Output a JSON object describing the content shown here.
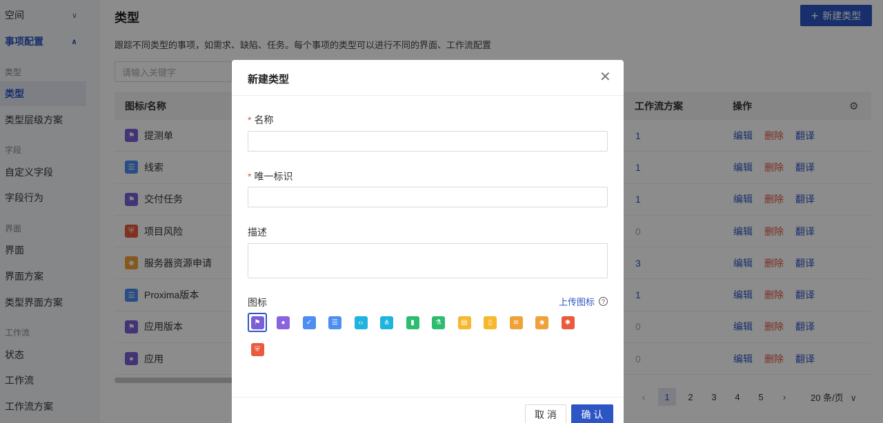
{
  "sidebar": {
    "space": "空间",
    "item_config": "事项配置",
    "section_type": "类型",
    "type": "类型",
    "type_level": "类型层级方案",
    "section_field": "字段",
    "custom_field": "自定义字段",
    "field_behavior": "字段行为",
    "section_screen": "界面",
    "screen": "界面",
    "screen_scheme": "界面方案",
    "type_screen_scheme": "类型界面方案",
    "section_workflow": "工作流",
    "status": "状态",
    "workflow": "工作流",
    "workflow_scheme": "工作流方案"
  },
  "page": {
    "title": "类型",
    "description": "跟踪不同类型的事项，如需求、缺陷、任务。每个事项的类型可以进行不同的界面、工作流配置",
    "new_button": "新建类型",
    "search_placeholder": "请输入关键字"
  },
  "table": {
    "col_name": "图标/名称",
    "col_workflow": "工作流方案",
    "col_ops": "操作",
    "op_edit": "编辑",
    "op_delete": "删除",
    "op_translate": "翻译",
    "rows": [
      {
        "name": "提测单",
        "workflow": "1",
        "icon": "flag-icon",
        "color": "#7b5fd6"
      },
      {
        "name": "线索",
        "workflow": "1",
        "icon": "list-icon",
        "color": "#4e8ef0"
      },
      {
        "name": "交付任务",
        "workflow": "1",
        "icon": "flag-icon",
        "color": "#7b5fd6"
      },
      {
        "name": "项目风险",
        "workflow": "0",
        "icon": "shield-icon",
        "color": "#e95a3f"
      },
      {
        "name": "服务器资源申请",
        "workflow": "3",
        "icon": "person-icon",
        "color": "#f0a23a"
      },
      {
        "name": "Proxima版本",
        "workflow": "1",
        "icon": "list-icon",
        "color": "#4e8ef0"
      },
      {
        "name": "应用版本",
        "workflow": "0",
        "icon": "flag-icon",
        "color": "#7b5fd6"
      },
      {
        "name": "应用",
        "workflow": "0",
        "icon": "bulb-icon",
        "color": "#7b5fd6"
      }
    ]
  },
  "pagination": {
    "pages": [
      "1",
      "2",
      "3",
      "4",
      "5"
    ],
    "current": "1",
    "page_size": "20 条/页"
  },
  "modal": {
    "title": "新建类型",
    "name_label": "名称",
    "key_label": "唯一标识",
    "desc_label": "描述",
    "icon_label": "图标",
    "upload_icon": "上传图标",
    "cancel": "取 消",
    "confirm": "确 认",
    "required_mark": "*",
    "icons": [
      {
        "name": "flag-icon",
        "color": "#7b5fd6",
        "glyph": "⚑"
      },
      {
        "name": "bulb-icon",
        "color": "#8a63e0",
        "glyph": "●"
      },
      {
        "name": "check-icon",
        "color": "#4e8ef0",
        "glyph": "✓"
      },
      {
        "name": "list-icon",
        "color": "#4e8ef0",
        "glyph": "☰"
      },
      {
        "name": "code-icon",
        "color": "#1fb3e0",
        "glyph": "‹›"
      },
      {
        "name": "tree-icon",
        "color": "#1fb3e0",
        "glyph": "⋔"
      },
      {
        "name": "bookmark-icon",
        "color": "#2dbd6e",
        "glyph": "▮"
      },
      {
        "name": "flask-icon",
        "color": "#2dbd6e",
        "glyph": "⚗"
      },
      {
        "name": "book-icon",
        "color": "#f5b82e",
        "glyph": "▤"
      },
      {
        "name": "document-icon",
        "color": "#f5b82e",
        "glyph": "▯"
      },
      {
        "name": "layers-icon",
        "color": "#f0a23a",
        "glyph": "≋"
      },
      {
        "name": "person-icon",
        "color": "#f0a23a",
        "glyph": "☻"
      },
      {
        "name": "bug-icon",
        "color": "#e95a3f",
        "glyph": "✱"
      },
      {
        "name": "shield-icon",
        "color": "#e95a3f",
        "glyph": "⛨"
      }
    ]
  }
}
